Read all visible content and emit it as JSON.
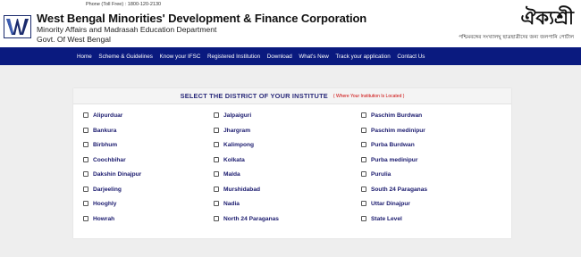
{
  "header": {
    "phone": "Phone (Toll Free) : 1800-120-2130",
    "org_title": "West Bengal Minorities' Development & Finance Corporation",
    "department": "Minority Affairs and Madrasah Education Department",
    "govt": "Govt. Of West Bengal",
    "brand_name": "ঐক্যশ্রী",
    "brand_tagline": "পশ্চিমবঙ্গের সংখ্যালঘু ছাত্রছাত্রীদের জন্য জলপানি পোর্টাল"
  },
  "nav": {
    "items": [
      "Home",
      "Scheme & Guidelines",
      "Know your IFSC",
      "Registered Institution",
      "Download",
      "What's New",
      "Track your application",
      "Contact Us"
    ]
  },
  "panel": {
    "title": "SELECT THE DISTRICT OF YOUR INSTITUTE",
    "note": "( Where Your Institution Is Located )"
  },
  "districts": {
    "col1": [
      "Alipurduar",
      "Bankura",
      "Birbhum",
      "Coochbihar",
      "Dakshin Dinajpur",
      "Darjeeling",
      "Hooghly",
      "Howrah"
    ],
    "col2": [
      "Jalpaiguri",
      "Jhargram",
      "Kalimpong",
      "Kolkata",
      "Malda",
      "Murshidabad",
      "Nadia",
      "North 24 Paraganas"
    ],
    "col3": [
      "Paschim Burdwan",
      "Paschim medinipur",
      "Purba Burdwan",
      "Purba medinipur",
      "Purulia",
      "South 24 Paraganas",
      "Uttar Dinajpur",
      "State Level"
    ]
  }
}
